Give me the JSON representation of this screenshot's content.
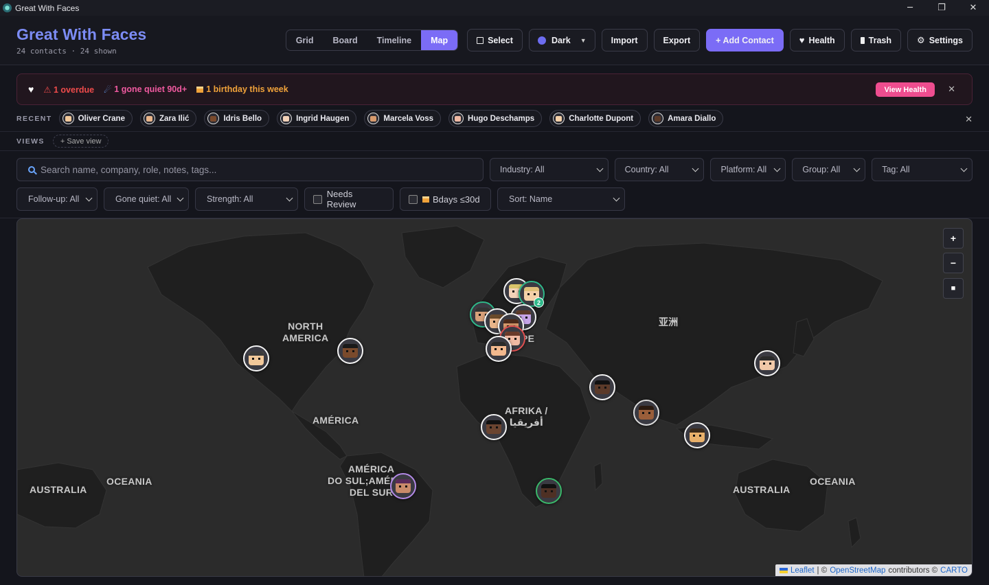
{
  "window": {
    "title": "Great With Faces",
    "minimize": "─",
    "maximize": "❐",
    "close": "✕"
  },
  "header": {
    "title": "Great With Faces",
    "subtitle": "24 contacts · 24 shown",
    "views": [
      "Grid",
      "Board",
      "Timeline",
      "Map"
    ],
    "active_view": "Map",
    "select": "Select",
    "theme": "Dark",
    "theme_caret": "▼",
    "import": "Import",
    "export": "Export",
    "add_contact": "+ Add Contact",
    "health": "Health",
    "trash": "Trash",
    "settings": "Settings"
  },
  "alert": {
    "overdue": "⚠ 1 overdue",
    "quiet": "1 gone quiet 90d+",
    "birthday": "1 birthday this week",
    "view_health": "View Health",
    "close": "✕"
  },
  "recent": {
    "label": "RECENT",
    "close": "✕",
    "items": [
      {
        "name": "Oliver Crane",
        "skin": "#f1c89a"
      },
      {
        "name": "Zara Ilić",
        "skin": "#e9b58a"
      },
      {
        "name": "Idris Bello",
        "skin": "#7a4a2c"
      },
      {
        "name": "Ingrid Haugen",
        "skin": "#f3d2b8"
      },
      {
        "name": "Marcela Voss",
        "skin": "#d79a6c"
      },
      {
        "name": "Hugo Deschamps",
        "skin": "#f0b9a3"
      },
      {
        "name": "Charlotte Dupont",
        "skin": "#f4d0a8"
      },
      {
        "name": "Amara Diallo",
        "skin": "#5b3a29"
      }
    ]
  },
  "views": {
    "label": "VIEWS",
    "save": "+ Save view"
  },
  "filters": {
    "search_placeholder": "Search name, company, role, notes, tags...",
    "industry": "Industry: All",
    "country": "Country: All",
    "platform": "Platform: All",
    "group": "Group: All",
    "tag": "Tag: All",
    "followup": "Follow-up: All",
    "gone_quiet": "Gone quiet: All",
    "strength": "Strength: All",
    "needs_review": "Needs Review",
    "bdays": "Bdays ≤30d",
    "sort": "Sort: Name"
  },
  "map": {
    "zoom_in": "+",
    "zoom_out": "−",
    "fullscreen": "■",
    "cluster_count": "2",
    "regions": {
      "north_america": "NORTH\nAMERICA",
      "america": "AMÉRICA",
      "south_america": "AMÉRICA\nDO SUL;AMÉRICA\nDEL SUR",
      "europe_suffix": "PE",
      "africa": "AFRIKA /\nأفريقيا",
      "asia": "亚洲",
      "australia_left": "AUSTRALIA",
      "oceania_left": "OCEANIA",
      "australia_right": "AUSTRALIA",
      "oceania_right": "OCEANIA"
    },
    "attribution": {
      "leaflet": "Leaflet",
      "sep": "| ©",
      "osm": "OpenStreetMap",
      "contributors": "contributors ©",
      "carto": "CARTO"
    }
  }
}
